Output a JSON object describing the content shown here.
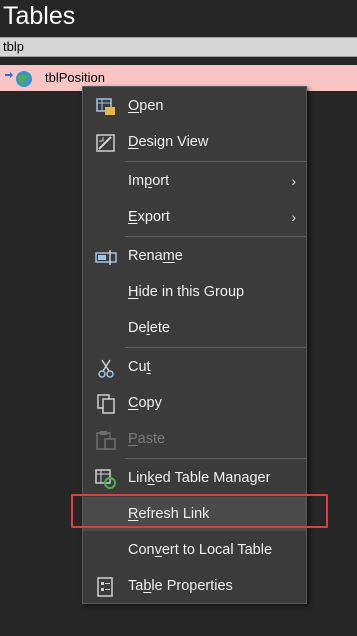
{
  "pane": {
    "title": "Tables",
    "search_value": "tblp"
  },
  "table_item": {
    "label": "tblPosition"
  },
  "menu": {
    "open": {
      "before": "",
      "accel": "O",
      "after": "pen"
    },
    "design_view": {
      "before": "",
      "accel": "D",
      "after": "esign View"
    },
    "import": {
      "before": "Im",
      "accel": "p",
      "after": "ort"
    },
    "export": {
      "before": "",
      "accel": "E",
      "after": "xport"
    },
    "rename": {
      "before": "Rena",
      "accel": "m",
      "after": "e"
    },
    "hide": {
      "before": "",
      "accel": "H",
      "after": "ide in this Group"
    },
    "delete": {
      "before": "De",
      "accel": "l",
      "after": "ete"
    },
    "cut": {
      "before": "Cu",
      "accel": "t",
      "after": ""
    },
    "copy": {
      "before": "",
      "accel": "C",
      "after": "opy"
    },
    "paste": {
      "before": "",
      "accel": "P",
      "after": "aste"
    },
    "linked_table_manager": {
      "before": "Lin",
      "accel": "k",
      "after": "ed Table Manager"
    },
    "refresh_link": {
      "before": "",
      "accel": "R",
      "after": "efresh Link"
    },
    "convert": {
      "before": "Con",
      "accel": "v",
      "after": "ert to Local Table"
    },
    "properties": {
      "before": "Ta",
      "accel": "b",
      "after": "le Properties"
    },
    "submenu_arrow": "›"
  },
  "colors": {
    "highlight_border": "#e03c3c",
    "selected_row": "#f8c4c4",
    "menu_bg": "#3b3b3b"
  }
}
